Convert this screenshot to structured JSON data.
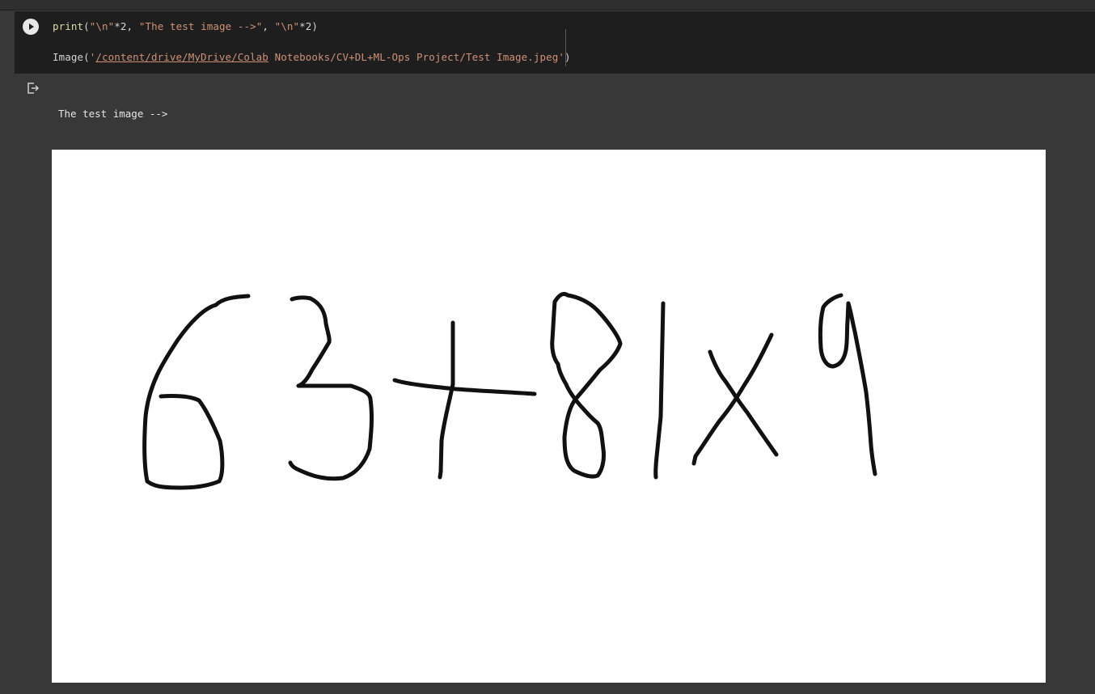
{
  "code_cell": {
    "run_icon": "play-icon",
    "line1": {
      "fn": "print",
      "open": "(",
      "arg1": "\"\\n\"",
      "op1": "*2, ",
      "arg2": "\"The test image -->\"",
      "sep": ", ",
      "arg3": "\"\\n\"",
      "op2": "*2)"
    },
    "line2": {
      "fn": "Image(",
      "quote_open": "'",
      "path_link": "/content/drive/MyDrive/Colab",
      "path_rest": " Notebooks/CV+DL+ML-Ops Project/Test Image.jpeg'",
      "close": ")"
    }
  },
  "output": {
    "icon": "output-redirect-icon",
    "text": "The test image -->",
    "image_description_icon": "handwritten-digits-image"
  },
  "colors": {
    "background": "#383838",
    "code_background": "#1e1e1e",
    "function": "#dcdcaa",
    "string": "#ce9178",
    "text": "#d4d4d4"
  }
}
